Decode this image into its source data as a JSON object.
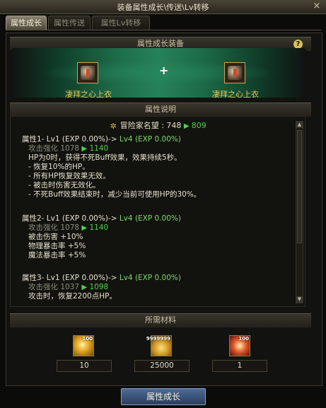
{
  "window": {
    "title": "装备属性成长\\传送\\Lv转移",
    "close": "×"
  },
  "tabs": [
    {
      "label": "属性成长"
    },
    {
      "label": "属性传送"
    },
    {
      "label": "属性Lv转移"
    }
  ],
  "equip_section": {
    "title": "属性成长装备",
    "help": "?",
    "plus": "+",
    "left_item": "凄拜之心上衣",
    "right_item": "凄拜之心上衣"
  },
  "desc_section": {
    "title": "属性说明",
    "reputation": {
      "label": "冒险家名望",
      "old": "748",
      "new": "809"
    },
    "attrs": [
      {
        "head": "属性1- Lv1 (EXP 0.00%)-> ",
        "head_new": "Lv4 (EXP 0.00%)",
        "sub_label": "攻击强化",
        "sub_old": "1078",
        "sub_new": "1140",
        "lines": [
          "HP为0时，获得不死Buff效果，效果持续5秒。",
          "- 恢复10%的HP。",
          "- 所有HP恢复效果无效。",
          "- 被击时伤害无效化。",
          "- 不死Buff效果结束时，减少当前可使用HP的30%。"
        ]
      },
      {
        "head": "属性2- Lv1 (EXP 0.00%)-> ",
        "head_new": "Lv4 (EXP 0.00%)",
        "sub_label": "攻击强化",
        "sub_old": "1078",
        "sub_new": "1140",
        "lines": [
          "被击伤害 +10%",
          "物理暴击率 +5%",
          "魔法暴击率 +5%"
        ]
      },
      {
        "head": "属性3- Lv1 (EXP 0.00%)-> ",
        "head_new": "Lv4 (EXP 0.00%)",
        "sub_label": "攻击强化",
        "sub_old": "1037",
        "sub_new": "1098",
        "lines": [
          "攻击时，恢复2200点HP。"
        ]
      }
    ]
  },
  "materials_section": {
    "title": "所需材料",
    "items": [
      {
        "icon": "gold-crystal-icon",
        "badge": "100",
        "amount": "10"
      },
      {
        "icon": "gold-coins-icon",
        "badge": "9999999",
        "amount": "25000"
      },
      {
        "icon": "fire-gem-icon",
        "badge": "100",
        "amount": "1"
      }
    ]
  },
  "bottom_button": "属性成长",
  "colors": {
    "accent_green": "#4fd14a",
    "item_gold": "#f0c24a",
    "button_blue": "#3b5478"
  }
}
